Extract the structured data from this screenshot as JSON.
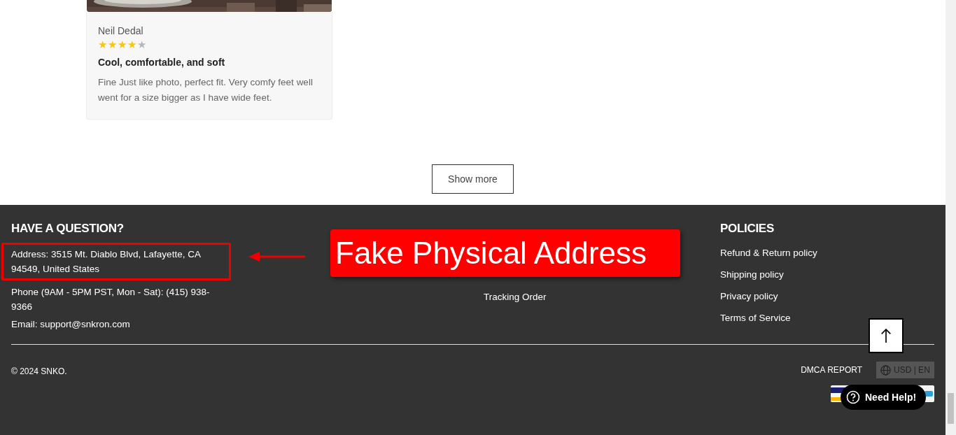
{
  "review": {
    "author": "Neil Dedal",
    "stars": 4,
    "title": "Cool, comfortable, and soft",
    "body": "Fine Just like photo, perfect fit. Very comfy feet well went for a size bigger as I have wide feet."
  },
  "show_more": "Show more",
  "footer": {
    "contact": {
      "heading": "HAVE A QUESTION?",
      "lines": [
        "Address: 3515 Mt. Diablo Blvd, Lafayette, CA 94549, United States",
        "Phone (9AM - 5PM PST, Mon - Sat): (415) 938-9366",
        "Email: support@snkron.com"
      ]
    },
    "support": {
      "links": [
        "Tracking Order"
      ]
    },
    "policies": {
      "heading": "POLICIES",
      "links": [
        "Refund & Return policy",
        "Shipping policy",
        "Privacy policy",
        "Terms of Service"
      ]
    },
    "copyright": "© 2024 SNKO.",
    "dmca": "DMCA REPORT",
    "currency": "USD | EN"
  },
  "chat_button": "Need Help!",
  "annotation": {
    "label": "Fake Physical Address"
  }
}
